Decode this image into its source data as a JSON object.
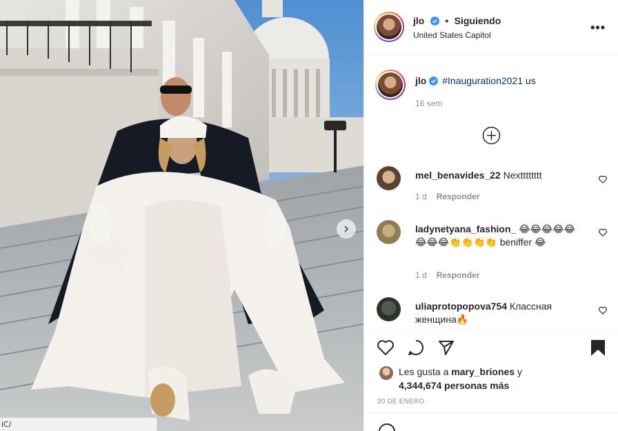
{
  "photo": {
    "alt_visible": false,
    "carousel_next_icon": "chevron-right-icon"
  },
  "browser": {
    "url_fragment": "iC/"
  },
  "header": {
    "username": "jlo",
    "separator": "•",
    "follow_status": "Siguiendo",
    "location": "United States Capitol",
    "more_icon": "more-horizontal-icon",
    "more_label": "•••"
  },
  "caption": {
    "username": "jlo",
    "hashtag": "#Inauguration2021",
    "text": " us",
    "time": "16 sem"
  },
  "load_more_icon": "plus-circle-icon",
  "comments": [
    {
      "username": "mel_benavides_22",
      "text": " Nextttttttt",
      "time": "1 d",
      "reply": "Responder"
    },
    {
      "username": "ladynetyana_fashion_",
      "text": " 😂😂😂😂😂😂😂😂👏👏👏👏 beniffer 😂",
      "time": "1 d",
      "reply": "Responder"
    },
    {
      "username": "uliaprotopopova754",
      "text": " Классная женщина🔥",
      "time": "",
      "reply": ""
    }
  ],
  "actions": {
    "like_icon": "heart-icon",
    "comment_icon": "comment-icon",
    "share_icon": "paper-plane-icon",
    "save_icon": "bookmark-icon"
  },
  "likes": {
    "prefix": "Les gusta a ",
    "user": "mary_briones",
    "joiner": " y",
    "count": "4,344,674 personas más"
  },
  "post_date": "20 DE ENERO",
  "colors": {
    "verified": "#3897f0",
    "hashtag": "#00376b",
    "muted": "#8e8e8e",
    "text": "#262626"
  }
}
